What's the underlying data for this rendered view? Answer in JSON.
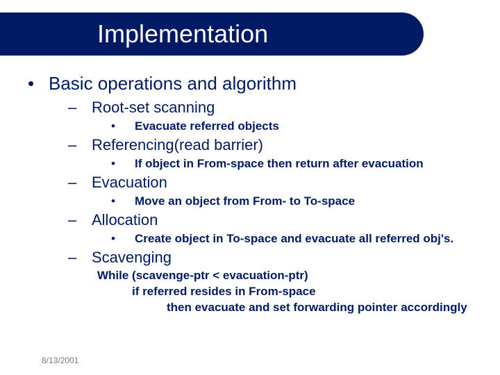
{
  "title": "Implementation",
  "main_bullet": "Basic operations and algorithm",
  "items": [
    {
      "heading": "Root-set scanning",
      "detail": "Evacuate referred objects"
    },
    {
      "heading": "Referencing(read barrier)",
      "detail": "If object in From-space then return after evacuation"
    },
    {
      "heading": "Evacuation",
      "detail": "Move an object from From- to To-space"
    },
    {
      "heading": "Allocation",
      "detail": "Create object in To-space and evacuate all referred obj's."
    },
    {
      "heading": "Scavenging",
      "detail": null
    }
  ],
  "scavenging_code": {
    "line1": "While (scavenge-ptr < evacuation-ptr)",
    "line2": "if referred resides in From-space",
    "line3": "then evacuate and set forwarding pointer accordingly"
  },
  "footer_date": "8/13/2001"
}
